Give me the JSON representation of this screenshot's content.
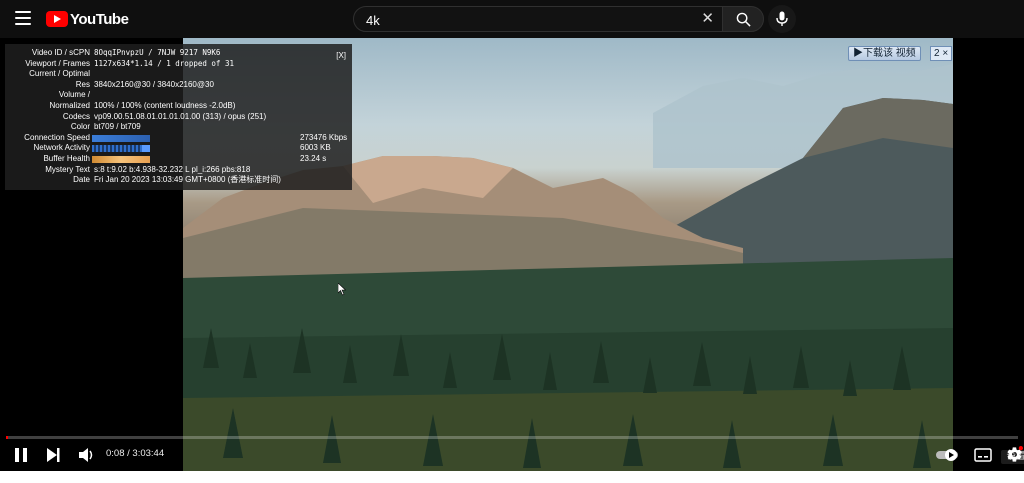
{
  "header": {
    "logo_text": "YouTube",
    "search_value": "4k"
  },
  "stats": {
    "close_label": "[X]",
    "rows": [
      {
        "key": "Video ID / sCPN",
        "value": "8OqqIPnvpzU / 7NJW 9217 N9K6"
      },
      {
        "key": "Viewport / Frames",
        "value": "1127x634*1.14 / 1 dropped of 31"
      },
      {
        "key": "Current / Optimal",
        "value": ""
      },
      {
        "key": "Res",
        "value": "3840x2160@30 / 3840x2160@30"
      },
      {
        "key": "Volume /",
        "value": ""
      },
      {
        "key": "Normalized",
        "value": "100% / 100% (content loudness -2.0dB)"
      },
      {
        "key": "Codecs",
        "value": "vp09.00.51.08.01.01.01.01.00 (313) / opus (251)"
      },
      {
        "key": "Color",
        "value": "bt709 / bt709"
      },
      {
        "key": "Connection Speed",
        "value": "273476 Kbps"
      },
      {
        "key": "Network Activity",
        "value": "6003 KB"
      },
      {
        "key": "Buffer Health",
        "value": "23.24 s"
      },
      {
        "key": "Mystery Text",
        "value": "s:8 t:9.02 b:4.938-32.232 L pl_i:266 pbs:818"
      },
      {
        "key": "Date",
        "value": "Fri Jan 20 2023 13:03:49 GMT+0800 (香港标准时间)"
      }
    ]
  },
  "overlay": {
    "download_label": "▶下载该 视频",
    "download_count": "2 ×"
  },
  "controls": {
    "time": "0:08 / 3:03:44",
    "progress_fraction": 0.0007,
    "settings_tooltip": "设置"
  },
  "colors": {
    "accent": "#ff0000",
    "background": "#0f0f0f"
  }
}
